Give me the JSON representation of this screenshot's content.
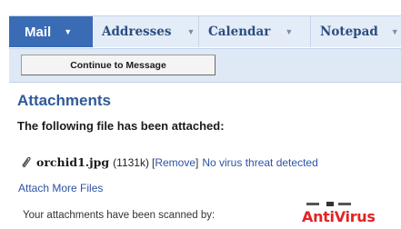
{
  "tabs": [
    {
      "label": "Mail",
      "active": true
    },
    {
      "label": "Addresses",
      "active": false
    },
    {
      "label": "Calendar",
      "active": false
    },
    {
      "label": "Notepad",
      "active": false
    }
  ],
  "toolbar": {
    "continue_label": "Continue to Message"
  },
  "content": {
    "heading": "Attachments",
    "subheading": "The following file has been attached:",
    "file": {
      "name": "orchid1.jpg",
      "size": "(1131k)",
      "open_bracket": "[",
      "remove_label": "Remove",
      "close_bracket": "]",
      "virus_status": "No virus threat detected"
    },
    "attach_more_label": "Attach More Files",
    "scanned_text": "Your attachments have been scanned by:",
    "antivirus_logo": "AntiVirus"
  },
  "colors": {
    "active_tab": "#3a6cb5",
    "tab_bar": "#e4ecf7",
    "heading": "#2e5a98",
    "link": "#2c53a5",
    "antivirus": "#e02424"
  },
  "icons": {
    "attachment": "paperclip-icon",
    "dropdown": "chevron-down-icon"
  }
}
